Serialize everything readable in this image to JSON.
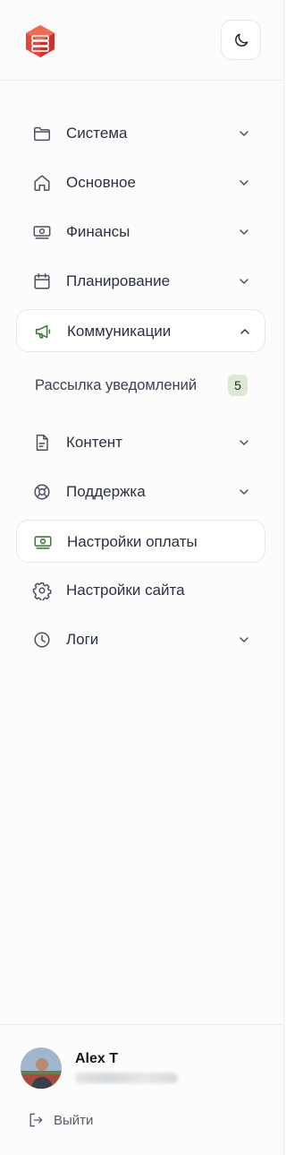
{
  "header": {
    "logo_icon": "stacked-cubes-logo",
    "theme_toggle_icon": "moon-icon"
  },
  "nav": {
    "items": [
      {
        "label": "Система",
        "icon": "folder-icon",
        "expandable": true,
        "expanded": false
      },
      {
        "label": "Основное",
        "icon": "home-icon",
        "expandable": true,
        "expanded": false
      },
      {
        "label": "Финансы",
        "icon": "banknote-icon",
        "expandable": true,
        "expanded": false
      },
      {
        "label": "Планирование",
        "icon": "calendar-icon",
        "expandable": true,
        "expanded": false
      },
      {
        "label": "Коммуникации",
        "icon": "megaphone-icon",
        "expandable": true,
        "expanded": true
      },
      {
        "label": "Контент",
        "icon": "document-icon",
        "expandable": true,
        "expanded": false
      },
      {
        "label": "Поддержка",
        "icon": "lifebuoy-icon",
        "expandable": true,
        "expanded": false
      },
      {
        "label": "Настройки оплаты",
        "icon": "banknote-icon",
        "expandable": false,
        "active": true
      },
      {
        "label": "Настройки сайта",
        "icon": "gear-icon",
        "expandable": false
      },
      {
        "label": "Логи",
        "icon": "clock-icon",
        "expandable": true,
        "expanded": false
      }
    ],
    "sub_items": [
      {
        "label": "Рассылка уведомлений",
        "badge": "5"
      }
    ]
  },
  "colors": {
    "accent_green": "#3f7a3a",
    "logo_red": "#e8463a",
    "badge_bg": "#dde8d6"
  },
  "user": {
    "name": "Alex T",
    "logout_label": "Выйти"
  }
}
